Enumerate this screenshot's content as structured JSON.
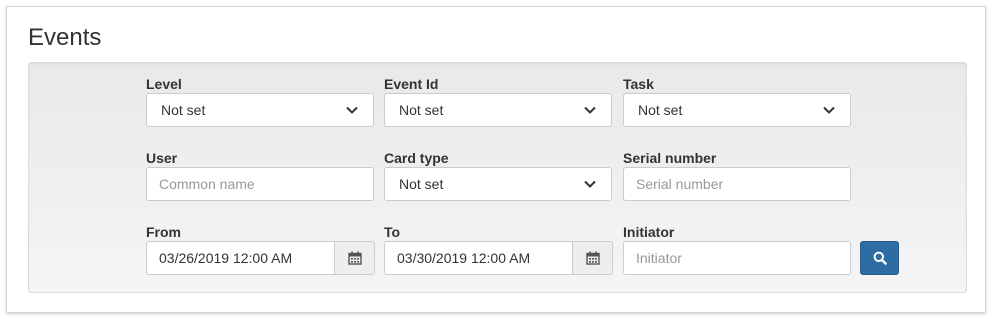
{
  "page": {
    "title": "Events"
  },
  "filters": {
    "level": {
      "label": "Level",
      "value": "Not set"
    },
    "event_id": {
      "label": "Event Id",
      "value": "Not set"
    },
    "task": {
      "label": "Task",
      "value": "Not set"
    },
    "user": {
      "label": "User",
      "placeholder": "Common name"
    },
    "card_type": {
      "label": "Card type",
      "value": "Not set"
    },
    "serial_number": {
      "label": "Serial number",
      "placeholder": "Serial number"
    },
    "from": {
      "label": "From",
      "value": "03/26/2019 12:00 AM"
    },
    "to": {
      "label": "To",
      "value": "03/30/2019 12:00 AM"
    },
    "initiator": {
      "label": "Initiator",
      "placeholder": "Initiator"
    }
  },
  "icons": {
    "select_arrow": "chevron-down-icon",
    "calendar": "calendar-icon",
    "search": "search-icon"
  },
  "colors": {
    "primary_button": "#2e6da4"
  }
}
